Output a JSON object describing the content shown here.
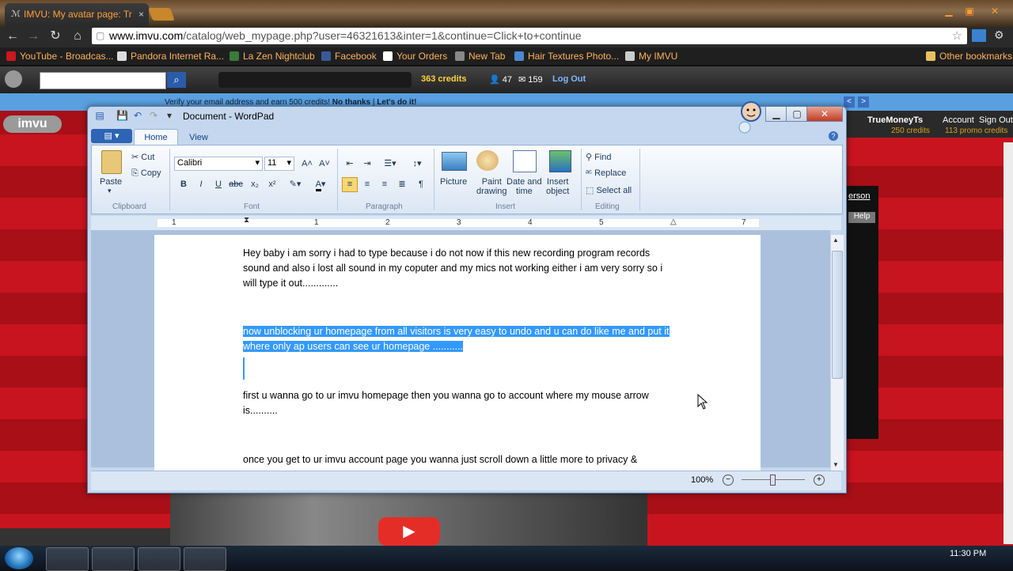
{
  "browser": {
    "tab_title": "IMVU: My avatar page: Tr",
    "tab_close": "×",
    "url_host": "www.imvu.com",
    "url_path": "/catalog/web_mypage.php?user=46321613&inter=1&continue=Click+to+continue",
    "bookmarks": [
      {
        "label": "YouTube - Broadcas...",
        "color": "#cc181e"
      },
      {
        "label": "Pandora Internet Ra...",
        "color": "#dddddd"
      },
      {
        "label": "La Zen Nightclub",
        "color": "#3a7a3a"
      },
      {
        "label": "Facebook",
        "color": "#3b5998"
      },
      {
        "label": "Your Orders",
        "color": "#ffffff"
      },
      {
        "label": "New Tab",
        "color": "#888888"
      },
      {
        "label": "Hair Textures Photo...",
        "color": "#4a88d0"
      },
      {
        "label": "My IMVU",
        "color": "#cccccc"
      }
    ],
    "other_bookmarks": "Other bookmarks"
  },
  "imvu_toolbar": {
    "credits": "363 credits",
    "friends": "47",
    "messages": "159",
    "logout": "Log Out"
  },
  "imvu_page": {
    "verify_text": "Verify your email address and earn 500 credits!",
    "no_thanks": "No thanks",
    "lets_do_it": "Let's do it!",
    "logo": "imvu",
    "username": "TrueMoneyTs",
    "account": "Account",
    "sign_out": "Sign Out",
    "credits_line": "250 credits",
    "promo_line": "113 promo credits",
    "person_label": "erson",
    "help_label": "Help"
  },
  "wordpad": {
    "title": "Document - WordPad",
    "tabs": {
      "home": "Home",
      "view": "View"
    },
    "clipboard": {
      "paste": "Paste",
      "cut": "Cut",
      "copy": "Copy",
      "group": "Clipboard"
    },
    "font": {
      "family": "Calibri",
      "size": "11",
      "group": "Font"
    },
    "paragraph": {
      "group": "Paragraph"
    },
    "insert": {
      "picture": "Picture",
      "paint_line1": "Paint",
      "paint_line2": "drawing",
      "date_line1": "Date and",
      "date_line2": "time",
      "object_line1": "Insert",
      "object_line2": "object",
      "group": "Insert"
    },
    "editing": {
      "find": "Find",
      "replace": "Replace",
      "select_all": "Select all",
      "group": "Editing"
    },
    "ruler": [
      "1",
      "1",
      "2",
      "3",
      "4",
      "5",
      "6",
      "7"
    ],
    "paragraphs": [
      "Hey baby i am sorry i had to type because i do not now if this new recording program  records sound and also i lost all sound in my coputer and my mics not working either i am very sorry so i will type it out.............",
      "now unblocking ur homepage from all visitors is very easy to undo and u can do like me and put it where only ap users can see ur homepage ...........",
      "first u wanna go to ur imvu homepage then you wanna go to account  where my mouse  arrow is..........",
      "once you get to ur imvu account page you wanna just scroll down a little more to privacy &"
    ],
    "zoom": "100%"
  },
  "taskbar": {
    "time": "11:30 PM"
  }
}
